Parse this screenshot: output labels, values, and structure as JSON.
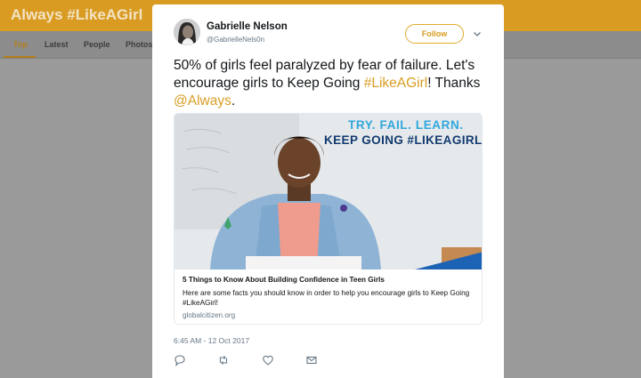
{
  "header": {
    "title": "Always #LikeAGirl"
  },
  "nav": {
    "tabs": [
      "Top",
      "Latest",
      "People",
      "Photos"
    ]
  },
  "tweet": {
    "author_name": "Gabrielle Nelson",
    "author_handle": "@GabrielleNels0n",
    "follow_label": "Follow",
    "text_part1": "50% of girls feel paralyzed by fear of failure. Let's encourage girls to Keep Going ",
    "hashtag": "#LikeAGirl",
    "text_part2": "! Thanks ",
    "mention": "@Always",
    "text_part3": ".",
    "timestamp": "6:45 AM - 12 Oct 2017"
  },
  "card": {
    "image_text_line1": "TRY. FAIL. LEARN.",
    "image_text_line2": "KEEP GOING #LIKEAGIRL",
    "title": "5 Things to Know About Building Confidence in Teen Girls",
    "description": "Here are some facts you should know in order to help you encourage girls to Keep Going #LikeAGirl!",
    "domain": "globalcitizen.org"
  },
  "actions": [
    "reply-icon",
    "retweet-icon",
    "like-icon",
    "message-icon"
  ],
  "colors": {
    "brand": "#d99b22",
    "accent": "#d89d23",
    "image_blue": "#2ea7dd",
    "image_navy": "#123b6f"
  }
}
